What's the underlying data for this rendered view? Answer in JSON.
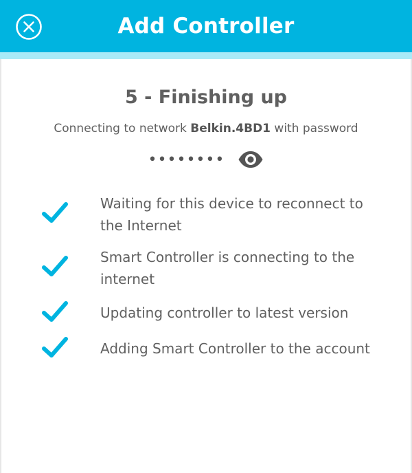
{
  "header": {
    "title": "Add Controller",
    "close_icon": "close-circle-icon",
    "background_color": "#00b4e0"
  },
  "step": {
    "title": "5 - Finishing up",
    "connecting_prefix": "Connecting to network",
    "network_name": "Belkin.4BD1",
    "connecting_suffix": "with password",
    "password_masked": "••••••••",
    "show_password_icon": "eye-icon"
  },
  "progress": {
    "check_color": "#00b4e0",
    "items": [
      {
        "label": "Waiting for this device to reconnect to the Internet",
        "status": "done"
      },
      {
        "label": "Smart Controller is connecting to the internet",
        "status": "done"
      },
      {
        "label": "Updating controller to latest version",
        "status": "done"
      },
      {
        "label": "Adding Smart Controller to the account",
        "status": "done"
      }
    ]
  }
}
